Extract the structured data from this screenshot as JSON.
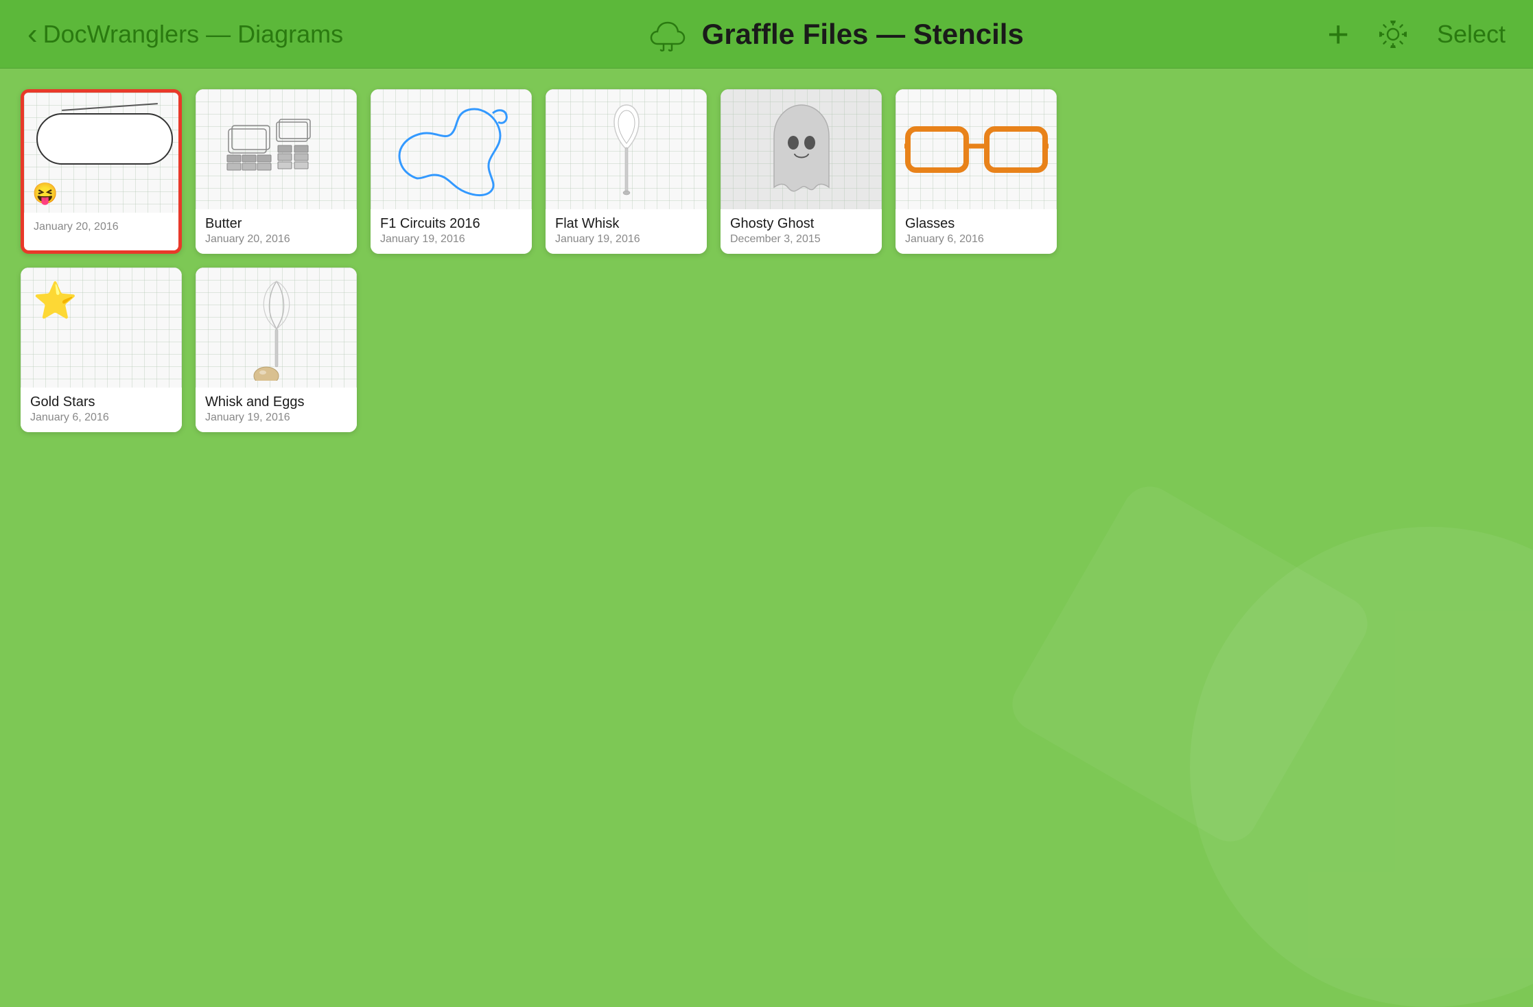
{
  "header": {
    "back_label": "DocWranglers — Diagrams",
    "title": "Graffle Files — Stencils",
    "plus_label": "+",
    "select_label": "Select"
  },
  "cards": {
    "row1": [
      {
        "id": "card-1",
        "name": "",
        "date": "January 20, 2016",
        "selected": true,
        "thumb_type": "emoji-shape"
      },
      {
        "id": "card-butter",
        "name": "Butter",
        "date": "January 20, 2016",
        "selected": false,
        "thumb_type": "butter"
      },
      {
        "id": "card-f1",
        "name": "F1 Circuits 2016",
        "date": "January 19, 2016",
        "selected": false,
        "thumb_type": "f1"
      },
      {
        "id": "card-whisk",
        "name": "Flat Whisk",
        "date": "January 19, 2016",
        "selected": false,
        "thumb_type": "flat-whisk"
      },
      {
        "id": "card-ghost",
        "name": "Ghosty Ghost",
        "date": "December 3, 2015",
        "selected": false,
        "thumb_type": "ghost"
      },
      {
        "id": "card-glasses",
        "name": "Glasses",
        "date": "January 6, 2016",
        "selected": false,
        "thumb_type": "glasses"
      }
    ],
    "row2": [
      {
        "id": "card-stars",
        "name": "Gold Stars",
        "date": "January 6, 2016",
        "selected": false,
        "thumb_type": "gold-stars"
      },
      {
        "id": "card-whisk-eggs",
        "name": "Whisk and Eggs",
        "date": "January 19, 2016",
        "selected": false,
        "thumb_type": "whisk-eggs"
      }
    ]
  }
}
